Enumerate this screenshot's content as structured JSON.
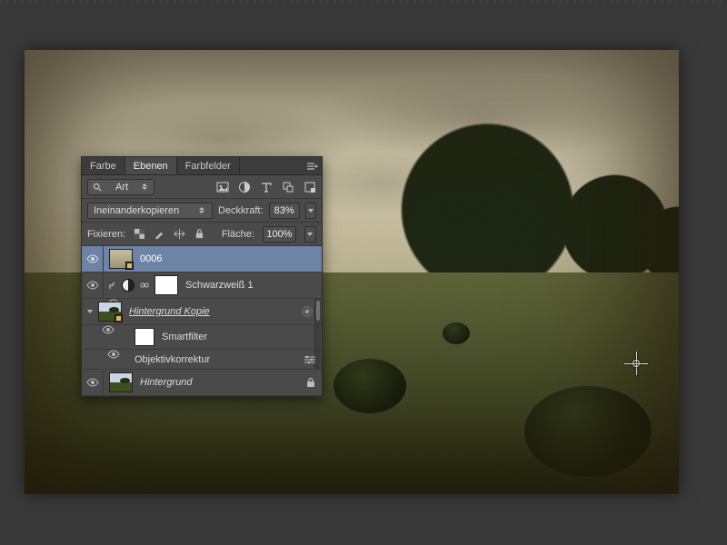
{
  "panel": {
    "tabs": {
      "color": "Farbe",
      "layers": "Ebenen",
      "swatches": "Farbfelder"
    },
    "filter_kind": "Art",
    "blend_mode": "Ineinanderkopieren",
    "opacity_label": "Deckkraft:",
    "opacity_value": "83%",
    "lock_label": "Fixieren:",
    "fill_label": "Fläche:",
    "fill_value": "100%"
  },
  "layers": {
    "texture": "0006",
    "bw_adjust": "Schwarzweiß 1",
    "bg_copy": "Hintergrund Kopie",
    "smartfilter": "Smartfilter",
    "lens_correction": "Objektivkorrektur",
    "background": "Hintergrund"
  }
}
